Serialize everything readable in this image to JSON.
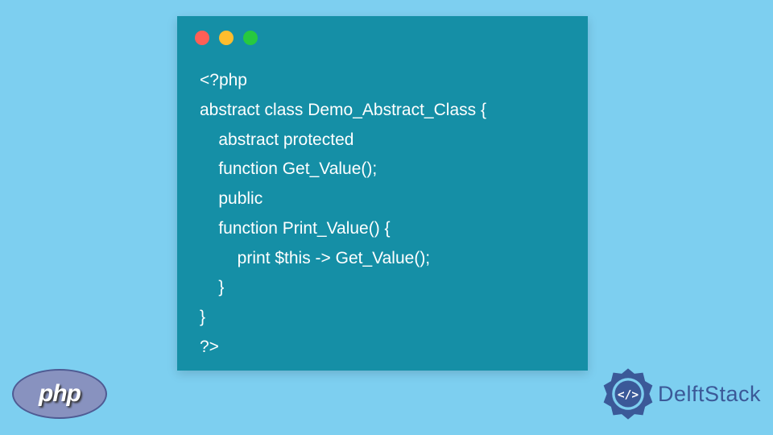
{
  "code": {
    "lines": "<?php\nabstract class Demo_Abstract_Class {\n    abstract protected\n    function Get_Value();\n    public\n    function Print_Value() {\n        print $this -> Get_Value();\n    }\n}\n?>"
  },
  "badges": {
    "php": {
      "label": "php"
    },
    "delft": {
      "label": "DelftStack",
      "icon_inner": "</>"
    }
  },
  "window": {
    "dots": [
      "red",
      "yellow",
      "green"
    ]
  }
}
